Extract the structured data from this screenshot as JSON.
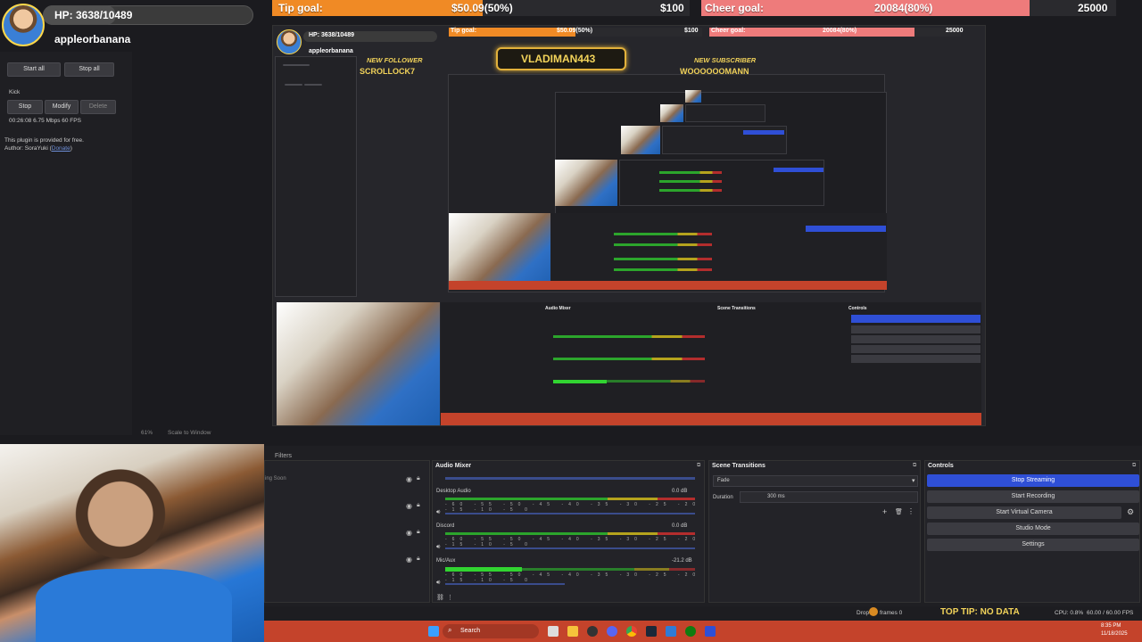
{
  "tip_goal": {
    "label": "Tip goal:",
    "amount": "$50.09(50%)",
    "target": "$100",
    "progress": 0.5,
    "color": "#f08a25"
  },
  "cheer_goal": {
    "label": "Cheer goal:",
    "amount": "20084(80%)",
    "target": "25000",
    "progress": 0.8,
    "color": "#ee7b7b"
  },
  "hp": {
    "text": "HP: 3638/10489",
    "name": "appleorbanana",
    "progress": 0.347
  },
  "plugin": {
    "start_all": "Start all",
    "stop_all": "Stop all",
    "kick_label": "Kick",
    "stop": "Stop",
    "modify": "Modify",
    "delete": "Delete",
    "stats": "00:26:08  6.75 Mbps  60 FPS",
    "free_note": "This plugin is provided for free.",
    "author_prefix": "Author: SoraYuki (",
    "author_link": "Donate",
    "author_suffix": ")"
  },
  "preview": {
    "hp_text": "HP: 3638/10489",
    "hp_name": "appleorbanana",
    "tip_label": "Tip goal:",
    "tip_amount": "$50.09(50%)",
    "tip_target": "$100",
    "cheer_label": "Cheer goal:",
    "cheer_amount": "20084(80%)",
    "cheer_target": "25000",
    "follower_tag": "NEW FOLLOWER",
    "follower_name": "SCROLLOCK7",
    "center_name": "VLADIMAN443",
    "subscriber_tag": "NEW SUBSCRIBER",
    "subscriber_name": "WOOOOOOMANN",
    "zoom": "61%",
    "scale": "Scale to Window"
  },
  "dock": {
    "filters": "Filters",
    "scene_hint": "ing Soon",
    "audio_mixer": "Audio Mixer",
    "channels": [
      {
        "name": "Desktop Audio",
        "db": "0.0 dB"
      },
      {
        "name": "Discord",
        "db": "0.0 dB"
      },
      {
        "name": "Mic/Aux",
        "db": "-21.2 dB"
      }
    ],
    "ticks": "-60 -55 -50 -45 -40 -35 -30 -25 -20 -15 -10 -5 0",
    "scene_transitions": "Scene Transitions",
    "transition": "Fade",
    "duration_label": "Duration",
    "duration_value": "300 ms",
    "controls": "Controls",
    "stop_streaming": "Stop Streaming",
    "start_recording": "Start Recording",
    "start_virtual_camera": "Start Virtual Camera",
    "studio_mode": "Studio Mode",
    "settings": "Settings"
  },
  "status": {
    "dropped": "Drop",
    "frames": "frames 0",
    "top_tip": "TOP TIP: NO DATA",
    "cpu": "CPU: 0.8%",
    "fps": "60.00 / 60.00 FPS"
  },
  "taskbar": {
    "search": "Search",
    "time": "8:35 PM",
    "date": "11/18/2025"
  },
  "icons": [
    "windows-icon",
    "search-icon",
    "file-explorer-icon",
    "chrome-icon",
    "steam-icon",
    "obs-icon",
    "xbox-icon"
  ]
}
